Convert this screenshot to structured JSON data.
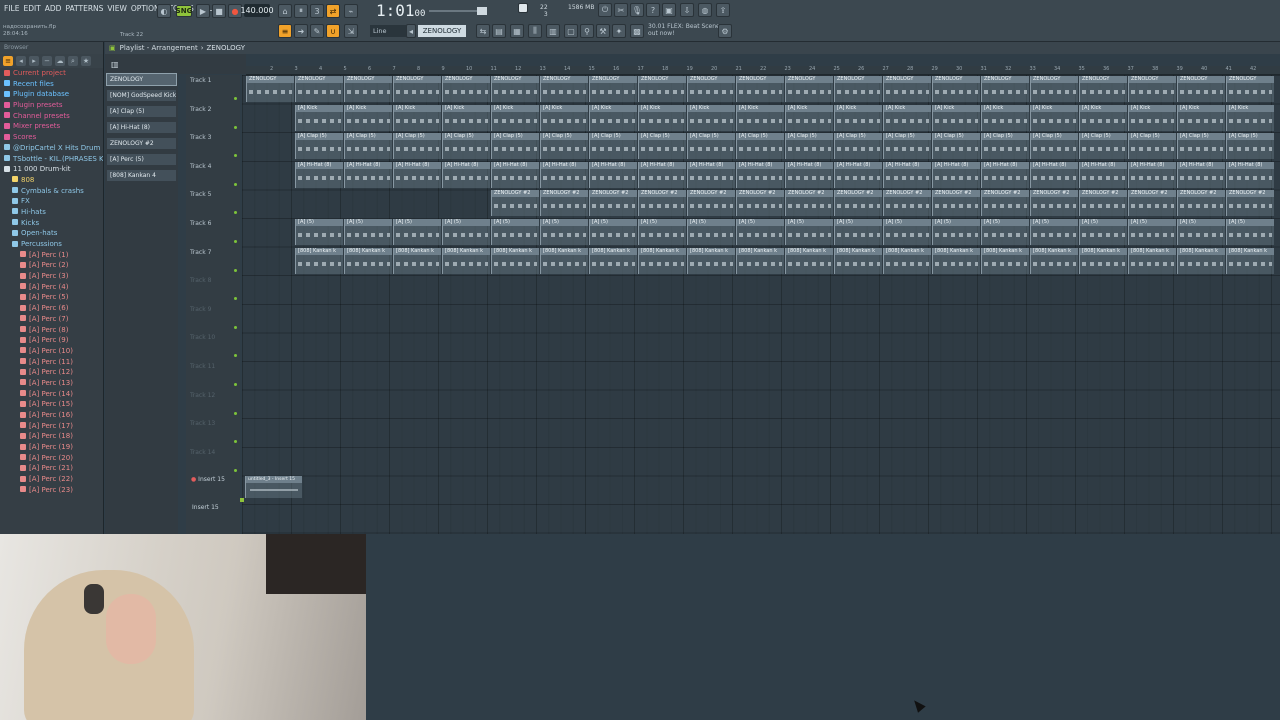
{
  "menu": [
    "FILE",
    "EDIT",
    "ADD",
    "PATTERNS",
    "VIEW",
    "OPTIONS",
    "TOOLS",
    "HELP"
  ],
  "toolbar": {
    "tempo": "140.000",
    "time": "1:01",
    "time_sub": "00",
    "pattern": "ZENOLOGY",
    "snap": "Line",
    "cpu_top": "22",
    "cpu_bottom": "3",
    "mem": "1586 MB",
    "news_line1": "30.01 FLEX: Beat Scene",
    "news_line2": "out now!",
    "file_line1": "надосохранить.flp",
    "file_line2": "28:04:16",
    "track_hint": "Track 22"
  },
  "playlist": {
    "title": "Playlist - Arrangement",
    "title_sep": "›",
    "pattern": "ZENOLOGY",
    "ruler_marks": [
      "2",
      "3",
      "4",
      "5",
      "6",
      "7",
      "8",
      "9",
      "10",
      "11",
      "12",
      "13",
      "14",
      "15",
      "16",
      "17",
      "18",
      "19",
      "20",
      "21",
      "22",
      "23",
      "24",
      "25",
      "26",
      "27",
      "28",
      "29",
      "30",
      "31",
      "32",
      "33",
      "34",
      "35",
      "36",
      "37",
      "38",
      "39",
      "40",
      "41",
      "42"
    ],
    "tracks": [
      "Track 1",
      "Track 2",
      "Track 3",
      "Track 4",
      "Track 5",
      "Track 6",
      "Track 7",
      "Track 8",
      "Track 9",
      "Track 10",
      "Track 11",
      "Track 12",
      "Track 13",
      "Track 14"
    ],
    "insert_label_top": "Insert 15",
    "insert_label_bottom": "Insert 15",
    "audio_clip": "untitled_3 - Insert 15",
    "clip_names": {
      "t1": "ZENOLOGY",
      "t2": "[A] Kick",
      "t3": "[A] Clap (5)",
      "t4": "[A] Hi-Hat (8)",
      "t5": "ZENOLOGY #2",
      "t6": "[A] (5)",
      "t7": "[808] Kankan k"
    }
  },
  "picker": {
    "header": "",
    "items": [
      "ZENOLOGY",
      "[NOM] GodSpeed Kick",
      "[A] Clap (5)",
      "[A] Hi-Hat (8)",
      "ZENOLOGY #2",
      "[A] Perc (5)",
      "[808] Kankan 4"
    ]
  },
  "browser": {
    "header": "Browser",
    "items": [
      {
        "label": "Current project",
        "color": "#e35c5c",
        "indent": 0
      },
      {
        "label": "Recent files",
        "color": "#6bc1ff",
        "indent": 0
      },
      {
        "label": "Plugin database",
        "color": "#6bc1ff",
        "indent": 0
      },
      {
        "label": "Plugin presets",
        "color": "#e35c9a",
        "indent": 0
      },
      {
        "label": "Channel presets",
        "color": "#e35c9a",
        "indent": 0
      },
      {
        "label": "Mixer presets",
        "color": "#e35c9a",
        "indent": 0
      },
      {
        "label": "Scores",
        "color": "#e35c9a",
        "indent": 0
      },
      {
        "label": "@DripCartel X Hits Drum Kit",
        "color": "#8fc8e8",
        "indent": 0
      },
      {
        "label": "TSbottle - KIL.(PHRASES KIT)",
        "color": "#8fc8e8",
        "indent": 0
      },
      {
        "label": "11 000 Drum-kit",
        "color": "#d7e0e6",
        "indent": 0
      },
      {
        "label": "808",
        "color": "#f4d46a",
        "indent": 1
      },
      {
        "label": "Cymbals & crashs",
        "color": "#8fc8e8",
        "indent": 1
      },
      {
        "label": "FX",
        "color": "#8fc8e8",
        "indent": 1
      },
      {
        "label": "Hi-hats",
        "color": "#8fc8e8",
        "indent": 1
      },
      {
        "label": "Kicks",
        "color": "#8fc8e8",
        "indent": 1
      },
      {
        "label": "Open-hats",
        "color": "#8fc8e8",
        "indent": 1
      },
      {
        "label": "Percussions",
        "color": "#8fc8e8",
        "indent": 1
      },
      {
        "label": "[A] Perc (1)",
        "color": "#e88a8a",
        "indent": 2
      },
      {
        "label": "[A] Perc (2)",
        "color": "#e88a8a",
        "indent": 2
      },
      {
        "label": "[A] Perc (3)",
        "color": "#e88a8a",
        "indent": 2
      },
      {
        "label": "[A] Perc (4)",
        "color": "#e88a8a",
        "indent": 2
      },
      {
        "label": "[A] Perc (5)",
        "color": "#e88a8a",
        "indent": 2
      },
      {
        "label": "[A] Perc (6)",
        "color": "#e88a8a",
        "indent": 2
      },
      {
        "label": "[A] Perc (7)",
        "color": "#e88a8a",
        "indent": 2
      },
      {
        "label": "[A] Perc (8)",
        "color": "#e88a8a",
        "indent": 2
      },
      {
        "label": "[A] Perc (9)",
        "color": "#e88a8a",
        "indent": 2
      },
      {
        "label": "[A] Perc (10)",
        "color": "#e88a8a",
        "indent": 2
      },
      {
        "label": "[A] Perc (11)",
        "color": "#e88a8a",
        "indent": 2
      },
      {
        "label": "[A] Perc (12)",
        "color": "#e88a8a",
        "indent": 2
      },
      {
        "label": "[A] Perc (13)",
        "color": "#e88a8a",
        "indent": 2
      },
      {
        "label": "[A] Perc (14)",
        "color": "#e88a8a",
        "indent": 2
      },
      {
        "label": "[A] Perc (15)",
        "color": "#e88a8a",
        "indent": 2
      },
      {
        "label": "[A] Perc (16)",
        "color": "#e88a8a",
        "indent": 2
      },
      {
        "label": "[A] Perc (17)",
        "color": "#e88a8a",
        "indent": 2
      },
      {
        "label": "[A] Perc (18)",
        "color": "#e88a8a",
        "indent": 2
      },
      {
        "label": "[A] Perc (19)",
        "color": "#e88a8a",
        "indent": 2
      },
      {
        "label": "[A] Perc (20)",
        "color": "#e88a8a",
        "indent": 2
      },
      {
        "label": "[A] Perc (21)",
        "color": "#e88a8a",
        "indent": 2
      },
      {
        "label": "[A] Perc (22)",
        "color": "#e88a8a",
        "indent": 2
      },
      {
        "label": "[A] Perc (23)",
        "color": "#e88a8a",
        "indent": 2
      }
    ]
  },
  "colors": {
    "accent": "#f1a22a",
    "green": "#8fc33b",
    "panel": "#353e45",
    "grid": "#2f3b44"
  }
}
